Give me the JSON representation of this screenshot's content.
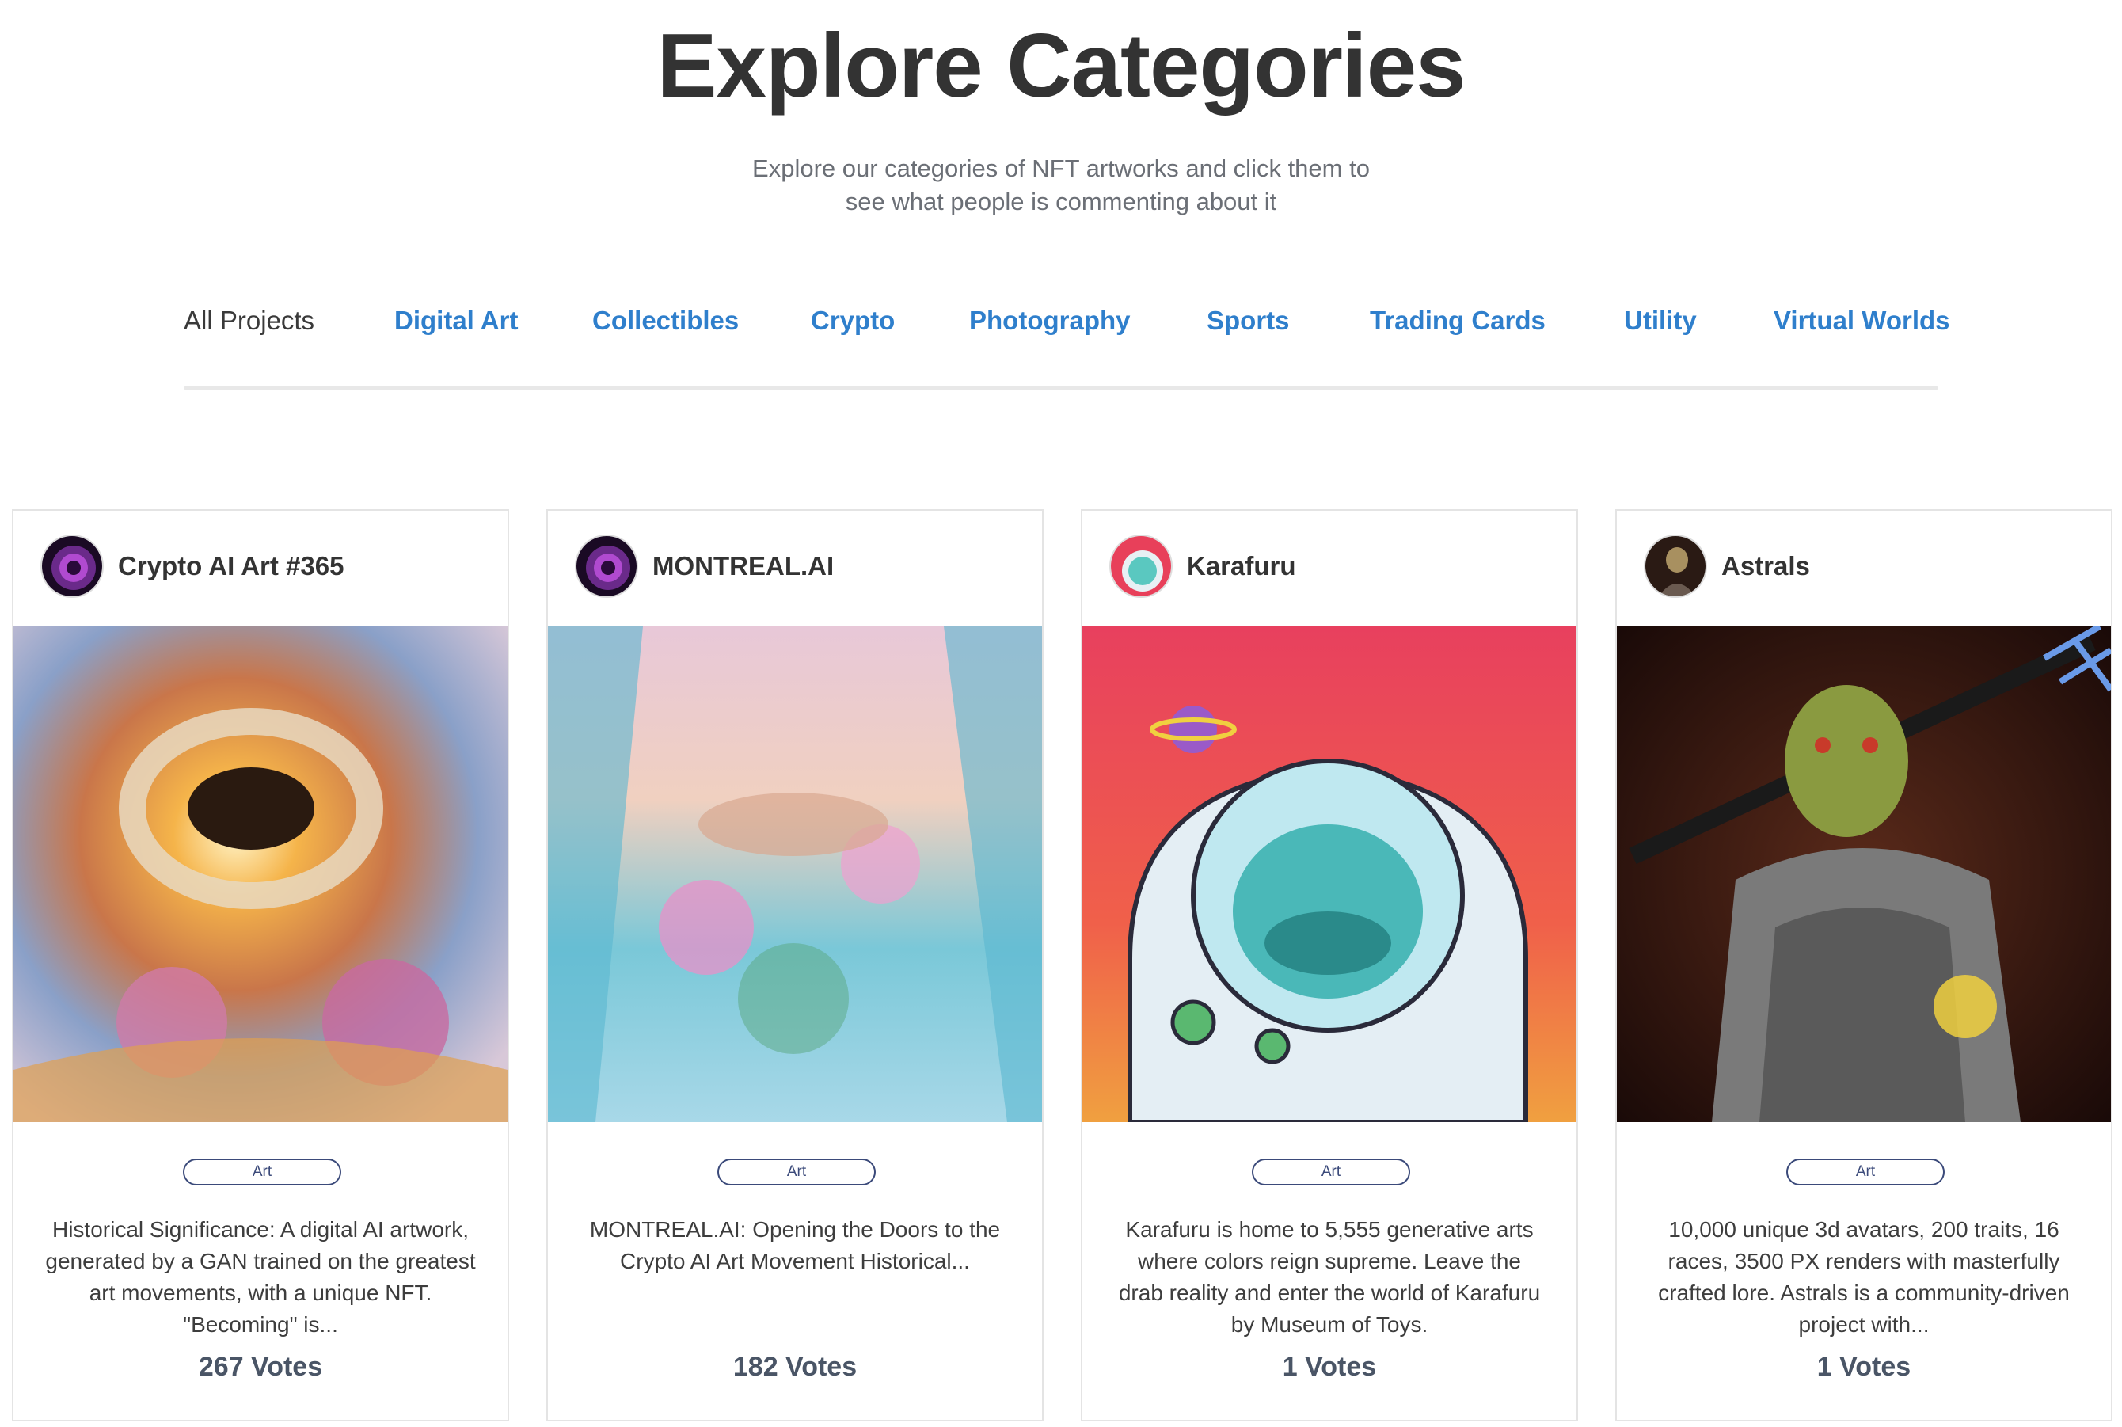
{
  "page": {
    "title": "Explore Categories",
    "subtitle_line1": "Explore our categories of NFT artworks and click them to",
    "subtitle_line2": "see what people is commenting about it"
  },
  "nav": {
    "items": [
      {
        "label": "All Projects",
        "active": true
      },
      {
        "label": "Digital Art",
        "active": false
      },
      {
        "label": "Collectibles",
        "active": false
      },
      {
        "label": "Crypto",
        "active": false
      },
      {
        "label": "Photography",
        "active": false
      },
      {
        "label": "Sports",
        "active": false
      },
      {
        "label": "Trading Cards",
        "active": false
      },
      {
        "label": "Utility",
        "active": false
      },
      {
        "label": "Virtual Worlds",
        "active": false
      }
    ]
  },
  "cards": [
    {
      "name": "Crypto AI Art #365",
      "badge": "Art",
      "description": "Historical Significance: A digital AI artwork, generated by a GAN trained on the greatest art movements, with a unique NFT. \"Becoming\" is...",
      "votes": "267 Votes"
    },
    {
      "name": "MONTREAL.AI",
      "badge": "Art",
      "description": "MONTREAL.AI: Opening the Doors to the Crypto AI Art Movement Historical...",
      "votes": "182 Votes"
    },
    {
      "name": "Karafuru",
      "badge": "Art",
      "description": "Karafuru is home to 5,555 generative arts where colors reign supreme. Leave the drab reality and enter the world of Karafuru by Museum of Toys.",
      "votes": "1 Votes"
    },
    {
      "name": "Astrals",
      "badge": "Art",
      "description": "10,000 unique 3d avatars, 200 traits, 16 races, 3500 PX renders with masterfully crafted lore. Astrals is a community-driven project with...",
      "votes": "1 Votes"
    }
  ],
  "colors": {
    "title": "#333333",
    "nav_link": "#2f7fcc",
    "nav_active": "#3a3a3a",
    "badge": "#3b4a7a",
    "votes": "#4a5566"
  }
}
